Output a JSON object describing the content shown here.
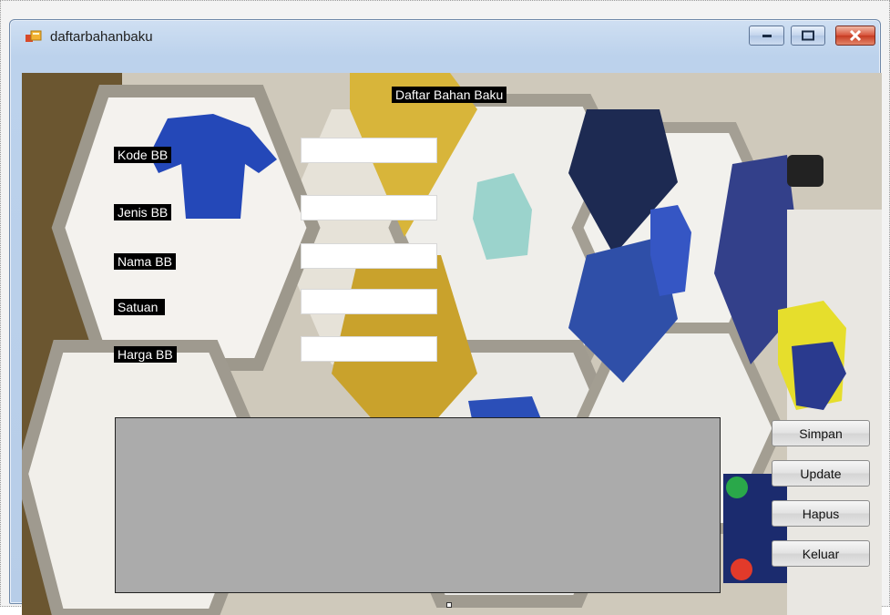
{
  "window": {
    "title": "daftarbahanbaku"
  },
  "form": {
    "heading": "Daftar Bahan Baku",
    "fields": [
      {
        "label": "Kode BB",
        "value": ""
      },
      {
        "label": "Jenis BB",
        "value": ""
      },
      {
        "label": "Nama BB",
        "value": ""
      },
      {
        "label": "Satuan",
        "value": ""
      },
      {
        "label": "Harga BB",
        "value": ""
      }
    ]
  },
  "buttons": {
    "simpan": "Simpan",
    "update": "Update",
    "hapus": "Hapus",
    "keluar": "Keluar"
  },
  "colors": {
    "label_bg": "#000000",
    "grid_bg": "#ababab",
    "titlebar": "#bcd2ec"
  }
}
